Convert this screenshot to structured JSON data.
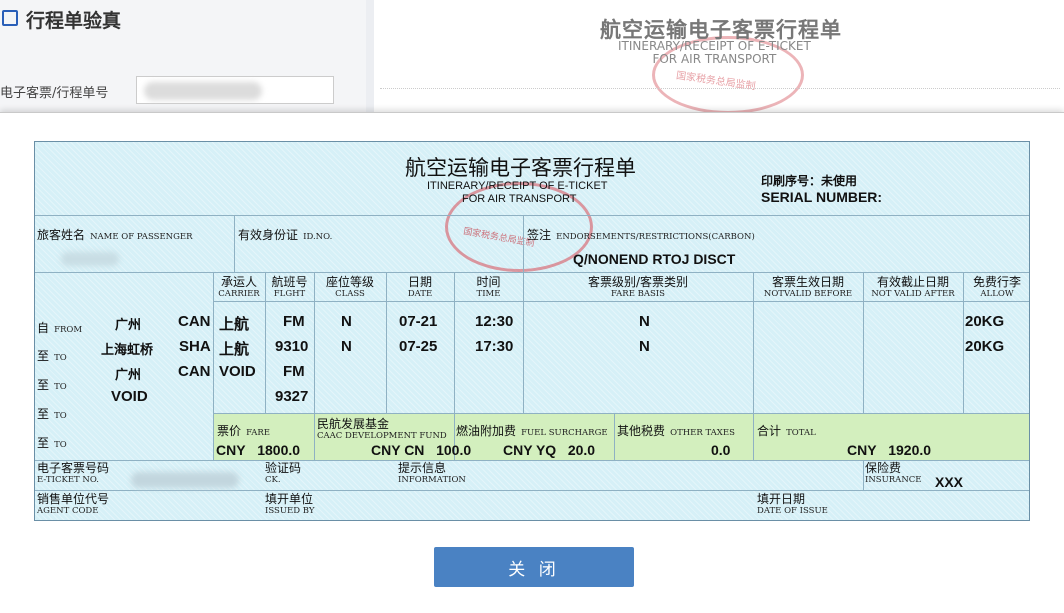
{
  "page": {
    "title": "行程单验真",
    "field_label": "电子客票/行程单号"
  },
  "background_doc": {
    "title_cn": "航空运输电子客票行程单",
    "title_en_1": "ITINERARY/RECEIPT OF E-TICKET",
    "title_en_2": "FOR AIR TRANSPORT",
    "stamp_text": "国家税务总局监制"
  },
  "ticket": {
    "title_cn": "航空运输电子客票行程单",
    "title_en_1": "ITINERARY/RECEIPT OF E-TICKET",
    "title_en_2": "FOR AIR TRANSPORT",
    "stamp_text": "国家税务总局监制",
    "serial_cn": "印刷序号：",
    "serial_value": "未使用",
    "serial_en": "SERIAL NUMBER:",
    "passenger": {
      "cn": "旅客姓名",
      "en": "NAME OF PASSENGER"
    },
    "id": {
      "cn": "有效身份证",
      "en": "ID.NO."
    },
    "endorse": {
      "cn": "签注",
      "en": "ENDORSEMENTS/RESTRICTIONS(CARBON)",
      "value": "Q/NONEND RTOJ DISCT"
    },
    "columns": {
      "carrier": {
        "cn": "承运人",
        "en": "CARRIER"
      },
      "flight": {
        "cn": "航班号",
        "en": "FLGHT"
      },
      "class": {
        "cn": "座位等级",
        "en": "CLASS"
      },
      "date": {
        "cn": "日期",
        "en": "DATE"
      },
      "time": {
        "cn": "时间",
        "en": "TIME"
      },
      "fare_basis": {
        "cn": "客票级别/客票类别",
        "en": "FARE BASIS"
      },
      "nvb": {
        "cn": "客票生效日期",
        "en": "NOTVALID BEFORE"
      },
      "nva": {
        "cn": "有效截止日期",
        "en": "NOT VALID AFTER"
      },
      "allow": {
        "cn": "免费行李",
        "en": "ALLOW"
      }
    },
    "row_labels": [
      {
        "cn": "自",
        "en": "FROM"
      },
      {
        "cn": "至",
        "en": "TO"
      },
      {
        "cn": "至",
        "en": "TO"
      },
      {
        "cn": "至",
        "en": "TO"
      },
      {
        "cn": "至",
        "en": "TO"
      }
    ],
    "rows": [
      {
        "city": "广州",
        "code": "CAN",
        "carrier": "上航",
        "flight": "FM",
        "class": "N",
        "date": "07-21",
        "time": "12:30",
        "fare_basis": "N",
        "allow": "20KG"
      },
      {
        "city": "上海虹桥",
        "code": "SHA",
        "carrier": "上航",
        "flight": "9310",
        "class": "N",
        "date": "07-25",
        "time": "17:30",
        "fare_basis": "N",
        "allow": "20KG"
      },
      {
        "city": "广州",
        "code": "CAN",
        "carrier": "VOID",
        "flight": "FM",
        "class": "",
        "date": "",
        "time": "",
        "fare_basis": "",
        "allow": ""
      },
      {
        "city": "VOID",
        "code": "",
        "carrier": "",
        "flight": "9327",
        "class": "",
        "date": "",
        "time": "",
        "fare_basis": "",
        "allow": ""
      }
    ],
    "fare": {
      "cn": "票价",
      "en": "FARE",
      "currency": "CNY",
      "value": "1800.0"
    },
    "caac": {
      "cn": "民航发展基金",
      "en": "CAAC DEVELOPMENT FUND",
      "value": "CNY CN",
      "amount": "100.0"
    },
    "fuel": {
      "cn": "燃油附加费",
      "en": "FUEL SURCHARGE",
      "value": "CNY YQ",
      "amount": "20.0"
    },
    "taxes": {
      "cn": "其他税费",
      "en": "OTHER TAXES",
      "value": "0.0"
    },
    "total": {
      "cn": "合计",
      "en": "TOTAL",
      "currency": "CNY",
      "value": "1920.0"
    },
    "eticket": {
      "cn": "电子客票号码",
      "en": "E-TICKET NO."
    },
    "ck": {
      "cn": "验证码",
      "en": "CK."
    },
    "info": {
      "cn": "提示信息",
      "en": "INFORMATION"
    },
    "insurance": {
      "cn": "保险费",
      "en": "INSURANCE",
      "value": "XXX"
    },
    "agent": {
      "cn": "销售单位代号",
      "en": "AGENT CODE"
    },
    "issued": {
      "cn": "填开单位",
      "en": "ISSUED BY"
    },
    "date_issue": {
      "cn": "填开日期",
      "en": "DATE OF ISSUE"
    }
  },
  "close_button": "关 闭",
  "colors": {
    "ticket_bg": "#d6f0f7",
    "fee_bg": "#d3efbe",
    "button": "#4a82c3",
    "stamp": "#d84b55"
  }
}
